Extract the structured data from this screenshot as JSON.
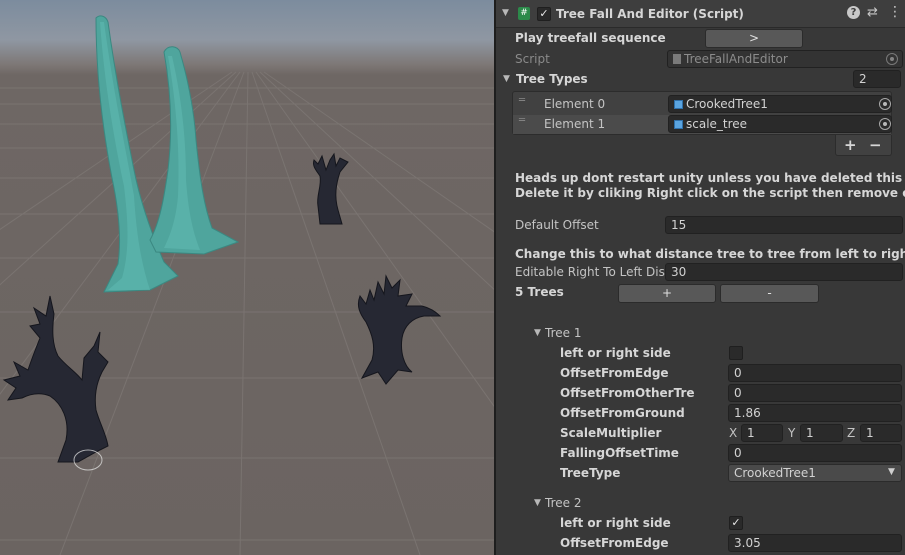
{
  "component": {
    "title": "Tree Fall And Editor (Script)",
    "script_icon": "script-hash-icon",
    "play_label": "Play treefall sequence",
    "play_button": ">",
    "script_label": "Script",
    "script_value": "TreeFallAndEditor"
  },
  "tree_types": {
    "label": "Tree Types",
    "count": "2",
    "elements": [
      {
        "label": "Element 0",
        "value": "CrookedTree1"
      },
      {
        "label": "Element 1",
        "value": "scale_tree"
      }
    ],
    "add_label": "+",
    "remove_label": "−"
  },
  "warning": {
    "line1": "Heads up dont restart unity unless you have deleted this componen",
    "line2": "Delete it by cliking Right click on the script then remove componen"
  },
  "offset": {
    "default_label": "Default Offset",
    "default_value": "15",
    "info": "Change this to what distance tree to tree from left to right should b",
    "editable_label": "Editable Right To Left Dist",
    "editable_value": "30"
  },
  "trees_section": {
    "label": "5 Trees",
    "add": "+",
    "remove": "-"
  },
  "tree1": {
    "title": "Tree 1",
    "side_label": "left or right side",
    "side_checked": false,
    "edge_label": "OffsetFromEdge",
    "edge_value": "0",
    "other_label": "OffsetFromOtherTre",
    "other_value": "0",
    "ground_label": "OffsetFromGround",
    "ground_value": "1.86",
    "scale_label": "ScaleMultiplier",
    "scale_x_label": "X",
    "scale_x": "1",
    "scale_y_label": "Y",
    "scale_y": "1",
    "scale_z_label": "Z",
    "scale_z": "1",
    "fall_label": "FallingOffsetTime",
    "fall_value": "0",
    "type_label": "TreeType",
    "type_value": "CrookedTree1"
  },
  "tree2": {
    "title": "Tree 2",
    "side_label": "left or right side",
    "side_checked": true,
    "check_mark": "✓",
    "edge_label": "OffsetFromEdge",
    "edge_value": "3.05"
  },
  "header_icons": [
    "help-icon",
    "preset-icon",
    "more-options-icon"
  ],
  "colors": {
    "inspector_bg": "#383838",
    "field_bg": "#2a2a2a",
    "teal_tree": "#4aa39a",
    "dark_tree": "#2a2c36"
  }
}
